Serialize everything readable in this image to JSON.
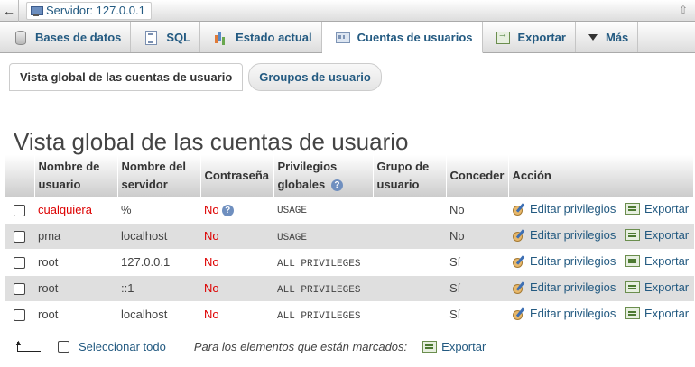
{
  "window": {
    "server_label": "Servidor: 127.0.0.1"
  },
  "menu": {
    "tabs": [
      {
        "label": "Bases de datos",
        "icon": "database-icon"
      },
      {
        "label": "SQL",
        "icon": "sql-icon"
      },
      {
        "label": "Estado actual",
        "icon": "status-chart-icon"
      },
      {
        "label": "Cuentas de usuarios",
        "icon": "user-accounts-icon",
        "active": true
      },
      {
        "label": "Exportar",
        "icon": "export-icon"
      },
      {
        "label": "Más",
        "icon": "chevron-down-icon"
      }
    ]
  },
  "subtabs": {
    "overview": "Vista global de las cuentas de usuario",
    "groups": "Groupos de usuario"
  },
  "page_title": "Vista global de las cuentas de usuario",
  "table": {
    "headers": {
      "user": "Nombre de usuario",
      "host": "Nombre del servidor",
      "password": "Contraseña",
      "privileges": "Privilegios globales",
      "group": "Grupo de usuario",
      "grant": "Conceder",
      "action": "Acción"
    },
    "rows": [
      {
        "user": "cualquiera",
        "host": "%",
        "password": "No",
        "privileges": "USAGE",
        "group": "",
        "grant": "No",
        "edit": "Editar privilegios",
        "export": "Exportar"
      },
      {
        "user": "pma",
        "host": "localhost",
        "password": "No",
        "privileges": "USAGE",
        "group": "",
        "grant": "No",
        "edit": "Editar privilegios",
        "export": "Exportar"
      },
      {
        "user": "root",
        "host": "127.0.0.1",
        "password": "No",
        "privileges": "ALL PRIVILEGES",
        "group": "",
        "grant": "Sí",
        "edit": "Editar privilegios",
        "export": "Exportar"
      },
      {
        "user": "root",
        "host": "::1",
        "password": "No",
        "privileges": "ALL PRIVILEGES",
        "group": "",
        "grant": "Sí",
        "edit": "Editar privilegios",
        "export": "Exportar"
      },
      {
        "user": "root",
        "host": "localhost",
        "password": "No",
        "privileges": "ALL PRIVILEGES",
        "group": "",
        "grant": "Sí",
        "edit": "Editar privilegios",
        "export": "Exportar"
      }
    ]
  },
  "footer": {
    "select_all": "Seleccionar todo",
    "with_selected": "Para los elementos que están marcados:",
    "export": "Exportar"
  },
  "colors": {
    "link": "#235a81",
    "warning": "#dd0000",
    "row_alt": "#dfdfdf"
  }
}
